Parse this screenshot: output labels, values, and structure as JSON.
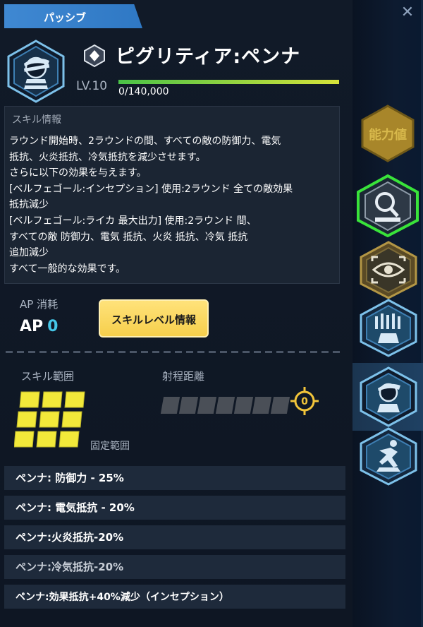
{
  "header": {
    "tab_label": "パッシブ",
    "close_icon": "close-icon"
  },
  "skill": {
    "name": "ピグリティア:ペンナ",
    "level": "LV.10",
    "exp_text": "0/140,000",
    "exp_progress": 1.0,
    "icon": "agent-visor-icon",
    "badge_icon": "diamond-badge-icon"
  },
  "info": {
    "title": "スキル情報",
    "lines": [
      "ラウンド開始時、2ラウンドの間、すべての敵の防御力、電気",
      "抵抗、火炎抵抗、冷気抵抗を減少させます。",
      "さらに以下の効果を与えます。",
      "[ベルフェゴール:インセプション] 使用:2ラウンド 全ての敵効果",
      "抵抗減少",
      "[ベルフェゴール:ライカ 最大出力] 使用:2ラウンド 間、",
      "すべての敵 防御力、電気 抵抗、火炎 抵抗、冷気 抵抗",
      "追加減少",
      "すべて一般的な効果です。"
    ]
  },
  "ap": {
    "label": "AP 消耗",
    "prefix": "AP",
    "value": "0"
  },
  "buttons": {
    "skill_level_info": "スキルレベル情報"
  },
  "range": {
    "label": "スキル範囲",
    "fixed_label": "固定範囲",
    "distance_label": "射程距離",
    "distance_value": "0"
  },
  "effects": [
    "ペンナ: 防御力 - 25%",
    "ペンナ: 電気抵抗 - 20%",
    "ペンナ:火炎抵抗-20%",
    "ペンナ:冷気抵抗-20%",
    "ペンナ:効果抵抗+40%減少（インセプション）"
  ],
  "sidebar": {
    "stats_label": "能力値",
    "items": [
      {
        "icon": "magnifier-icon"
      },
      {
        "icon": "eye-icon"
      },
      {
        "icon": "squad-icon"
      },
      {
        "icon": "agent-visor-icon"
      },
      {
        "icon": "runner-icon"
      }
    ]
  },
  "colors": {
    "accent_blue": "#3f88d2",
    "button_yellow": "#f6cf4c",
    "ap_cyan": "#45c7e8",
    "selected_green": "#39e33a",
    "range_yellow": "#f2e93a"
  }
}
